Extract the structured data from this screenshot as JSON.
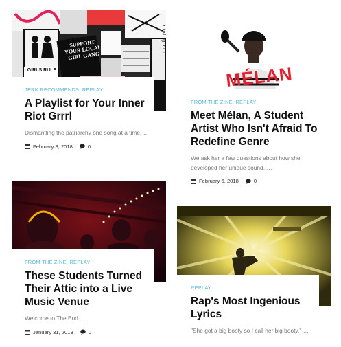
{
  "posts": [
    {
      "categories": [
        "JERK RECOMMENDS",
        "REPLAY"
      ],
      "title": "A Playlist for Your Inner Riot Grrrl",
      "excerpt": "Dismantling the patriarchy one song at a time. …",
      "date": "February 8, 2018",
      "comments": "0",
      "image_text": {
        "sticker": "SUPPORT YOUR LOCAL GIRL GANG",
        "sign": "GIRLS RULE",
        "side": "riot grrrl"
      }
    },
    {
      "categories": [
        "FROM THE ZINE",
        "REPLAY"
      ],
      "title": "Meet Mélan, A Student Artist Who Isn't Afraid To Redefine Genre",
      "excerpt": "We ask her a few questions about how she developed her unique sound. …",
      "date": "February 6, 2018",
      "comments": "0",
      "image_text": {
        "logo": "MÉLAN"
      }
    },
    {
      "categories": [
        "FROM THE ZINE",
        "REPLAY"
      ],
      "title": "These Students Turned Their Attic into a Live Music Venue",
      "excerpt": "Welcome to The End. …",
      "date": "January 31, 2018",
      "comments": "0"
    },
    {
      "categories": [
        "REPLAY"
      ],
      "title": "Rap's Most Ingenious Lyrics",
      "excerpt": "\"She got a big booty so I call her big booty.\" …",
      "date": "",
      "comments": ""
    }
  ],
  "colors": {
    "category": "#5bb8d8",
    "title": "#111111",
    "excerpt": "#777777"
  },
  "icons": {
    "date": "calendar-icon",
    "comments": "comment-bubble-icon"
  }
}
